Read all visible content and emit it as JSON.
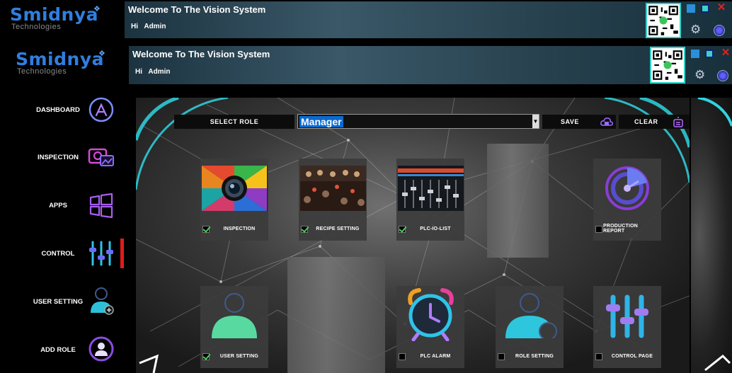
{
  "app": {
    "brand": "Smidnya",
    "brand_sub": "Technologies",
    "title": "Welcome To The Vision System",
    "greeting": "Hi",
    "user": "Admin"
  },
  "sidebar": {
    "items": [
      {
        "label": "DASHBOARD",
        "icon": "app-store-icon"
      },
      {
        "label": "INSPECTION",
        "icon": "camera-image-icon"
      },
      {
        "label": "APPS",
        "icon": "windows-icon"
      },
      {
        "label": "CONTROL",
        "icon": "sliders-icon",
        "active": true
      },
      {
        "label": "USER SETTING",
        "icon": "user-add-icon"
      },
      {
        "label": "ADD ROLE",
        "icon": "user-circle-icon"
      }
    ]
  },
  "role_bar": {
    "select_role_label": "SELECT ROLE",
    "selected_role": "Manager",
    "save_label": "SAVE",
    "clear_label": "CLEAR"
  },
  "tiles": [
    {
      "label": "INSPECTION",
      "checked": true
    },
    {
      "label": "RECIPE SETTING",
      "checked": true
    },
    {
      "label": "PLC-IO-LIST",
      "checked": true
    },
    {
      "label": "PRODUCTION REPORT",
      "checked": false
    },
    {
      "label": "USER SETTING",
      "checked": true
    },
    {
      "label": "PLC ALARM",
      "checked": false
    },
    {
      "label": "ROLE SETTING",
      "checked": false
    },
    {
      "label": "CONTROL PAGE",
      "checked": false
    }
  ],
  "colors": {
    "accent": "#2f7fe0",
    "active_indicator": "#e21b1b",
    "check": "#4ccf5a",
    "qr_border": "#2fd4c8"
  }
}
